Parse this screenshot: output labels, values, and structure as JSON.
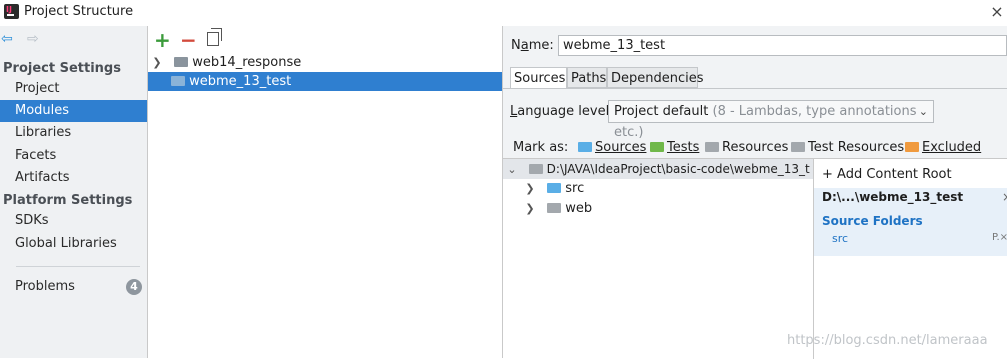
{
  "window": {
    "title": "Project Structure",
    "close_glyph": "×"
  },
  "sidebar": {
    "back_glyph": "⇦",
    "forward_glyph": "⇨",
    "project_settings_header": "Project Settings",
    "project_items": [
      {
        "label": "Project",
        "selected": false
      },
      {
        "label": "Modules",
        "selected": true
      },
      {
        "label": "Libraries",
        "selected": false
      },
      {
        "label": "Facets",
        "selected": false
      },
      {
        "label": "Artifacts",
        "selected": false
      }
    ],
    "platform_settings_header": "Platform Settings",
    "platform_items": [
      {
        "label": "SDKs"
      },
      {
        "label": "Global Libraries"
      }
    ],
    "problems_label": "Problems",
    "problems_count": "4"
  },
  "modules": {
    "add_glyph": "+",
    "remove_glyph": "−",
    "items": [
      {
        "label": "web14_response",
        "expanded": false,
        "selected": false
      },
      {
        "label": "webme_13_test",
        "expanded": false,
        "selected": true
      }
    ]
  },
  "detail": {
    "name_label_prefix": "N",
    "name_label_underlined": "a",
    "name_label_suffix": "me:",
    "name_value": "webme_13_test",
    "tabs": [
      "Sources",
      "Paths",
      "Dependencies"
    ],
    "active_tab": "Sources",
    "language_level_prefix": "",
    "language_level_underlined": "L",
    "language_level_suffix": "anguage level:",
    "language_level_value": "Project default",
    "language_level_hint": "(8 - Lambdas, type annotations etc.)",
    "mark_as_label": "Mark as:",
    "mark_sources": "Sources",
    "mark_tests": "Tests",
    "mark_resources": "Resources",
    "mark_test_resources": "Test Resources",
    "mark_excluded": "Excluded",
    "content_root_path": "D:\\JAVA\\IdeaProject\\basic-code\\webme_13_t",
    "children": [
      "src",
      "web"
    ],
    "add_content_root": "+ Add Content Root",
    "root_short_path": "D:\\...\\webme_13_test",
    "root_remove_glyph": "×",
    "source_folders_title": "Source Folders",
    "source_folder_entry": "src",
    "source_folder_flags": "P.×"
  },
  "watermark": "https://blog.csdn.net/lameraaa",
  "colors": {
    "selection": "#2f7fd0",
    "sources_folder": "#5aaee6",
    "tests_folder": "#70b84a",
    "excluded_folder": "#f09a3e",
    "add_green": "#3b9b3b",
    "remove_red": "#d24a3c"
  }
}
